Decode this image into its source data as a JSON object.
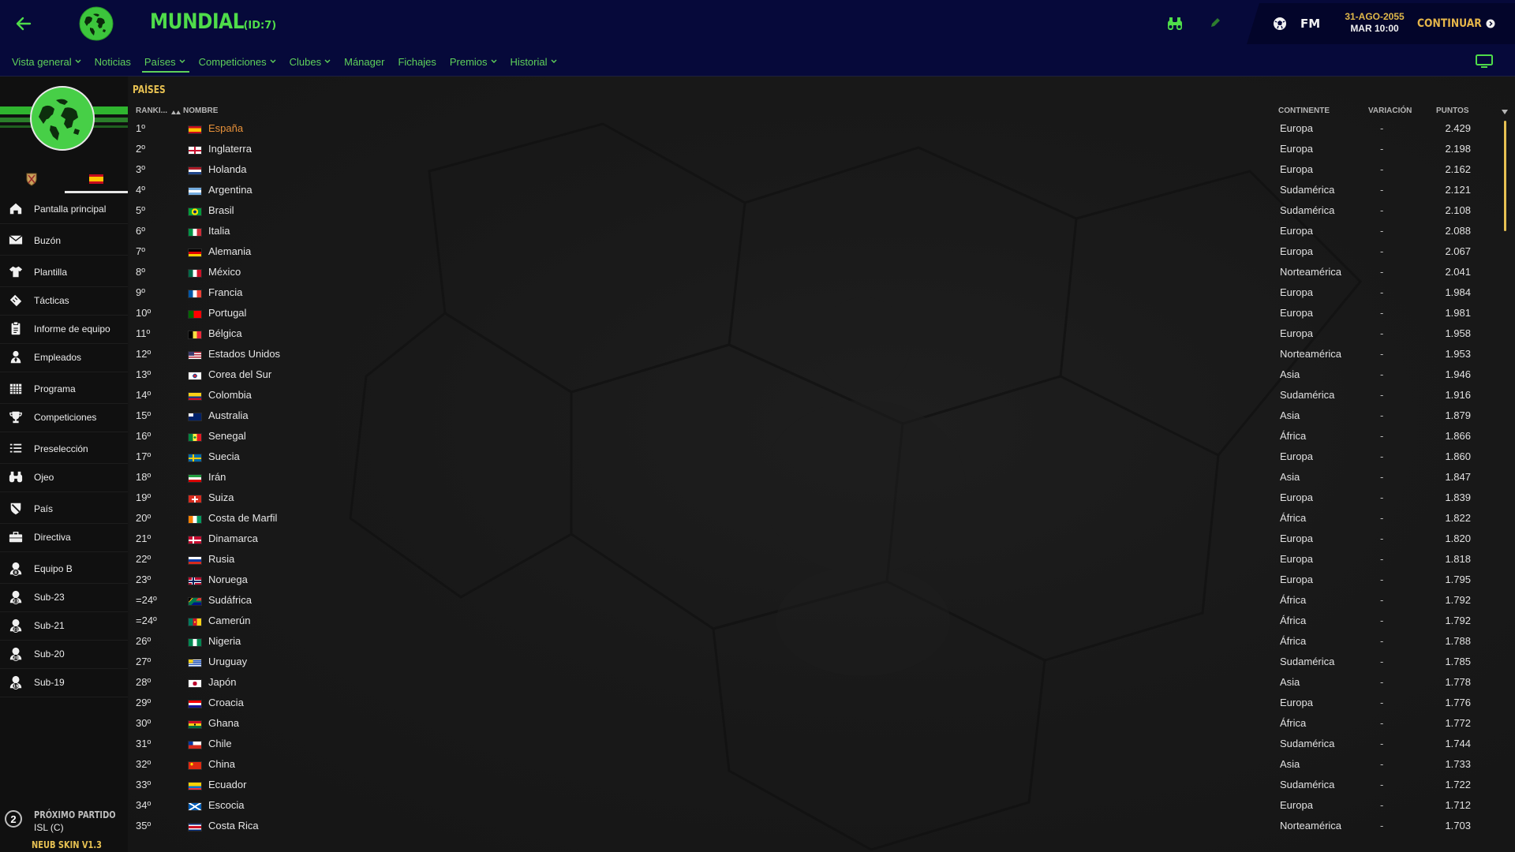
{
  "header": {
    "title": "MUNDIAL",
    "id_label": "(ID:7)",
    "fm_label": "FM",
    "date_top": "31-AGO-2055",
    "date_bottom": "MAR 10:00",
    "continue_label": "CONTINUAR"
  },
  "nav": {
    "items": [
      {
        "label": "Vista general",
        "dropdown": true
      },
      {
        "label": "Noticias",
        "dropdown": false
      },
      {
        "label": "Países",
        "dropdown": true,
        "active": true
      },
      {
        "label": "Competiciones",
        "dropdown": true
      },
      {
        "label": "Clubes",
        "dropdown": true
      },
      {
        "label": "Mánager",
        "dropdown": false
      },
      {
        "label": "Fichajes",
        "dropdown": false
      },
      {
        "label": "Premios",
        "dropdown": true
      },
      {
        "label": "Historial",
        "dropdown": true
      }
    ]
  },
  "sidebar": {
    "items": [
      {
        "label": "Pantalla principal",
        "icon": "home-icon"
      },
      {
        "label": "Buzón",
        "icon": "mail-icon"
      },
      {
        "label": "Plantilla",
        "icon": "shirt-icon"
      },
      {
        "label": "Tácticas",
        "icon": "tactics-icon"
      },
      {
        "label": "Informe de equipo",
        "icon": "report-icon"
      },
      {
        "label": "Empleados",
        "icon": "staff-icon"
      },
      {
        "label": "Programa",
        "icon": "calendar-icon"
      },
      {
        "label": "Competiciones",
        "icon": "trophy-icon"
      },
      {
        "label": "Preselección",
        "icon": "list-icon"
      },
      {
        "label": "Ojeo",
        "icon": "binoculars-icon"
      },
      {
        "label": "País",
        "icon": "shield-icon"
      },
      {
        "label": "Directiva",
        "icon": "briefcase-icon"
      },
      {
        "label": "Equipo B",
        "icon": "team-b-icon",
        "badge": "B"
      },
      {
        "label": "Sub-23",
        "icon": "u23-icon",
        "badge": "23"
      },
      {
        "label": "Sub-21",
        "icon": "u21-icon",
        "badge": "21"
      },
      {
        "label": "Sub-20",
        "icon": "u20-icon",
        "badge": "20"
      },
      {
        "label": "Sub-19",
        "icon": "u19-icon",
        "badge": "19"
      }
    ],
    "next_match": {
      "number": "2",
      "label": "PRÓXIMO PARTIDO",
      "opponent": "ISL (C)"
    },
    "skin_label": "NEUB SKIN V1.3"
  },
  "table": {
    "section_title": "PAÍSES",
    "columns": {
      "rank": "RANKI...",
      "name": "NOMBRE",
      "continent": "CONTINENTE",
      "variation": "VARIACIÓN",
      "points": "PUNTOS"
    },
    "rows": [
      {
        "rank": "1º",
        "name": "España",
        "continent": "Europa",
        "variation": "-",
        "points": "2.429",
        "flag": "es"
      },
      {
        "rank": "2º",
        "name": "Inglaterra",
        "continent": "Europa",
        "variation": "-",
        "points": "2.198",
        "flag": "en"
      },
      {
        "rank": "3º",
        "name": "Holanda",
        "continent": "Europa",
        "variation": "-",
        "points": "2.162",
        "flag": "nl"
      },
      {
        "rank": "4º",
        "name": "Argentina",
        "continent": "Sudamérica",
        "variation": "-",
        "points": "2.121",
        "flag": "ar"
      },
      {
        "rank": "5º",
        "name": "Brasil",
        "continent": "Sudamérica",
        "variation": "-",
        "points": "2.108",
        "flag": "br"
      },
      {
        "rank": "6º",
        "name": "Italia",
        "continent": "Europa",
        "variation": "-",
        "points": "2.088",
        "flag": "it"
      },
      {
        "rank": "7º",
        "name": "Alemania",
        "continent": "Europa",
        "variation": "-",
        "points": "2.067",
        "flag": "de"
      },
      {
        "rank": "8º",
        "name": "México",
        "continent": "Norteamérica",
        "variation": "-",
        "points": "2.041",
        "flag": "mx"
      },
      {
        "rank": "9º",
        "name": "Francia",
        "continent": "Europa",
        "variation": "-",
        "points": "1.984",
        "flag": "fr"
      },
      {
        "rank": "10º",
        "name": "Portugal",
        "continent": "Europa",
        "variation": "-",
        "points": "1.981",
        "flag": "pt"
      },
      {
        "rank": "11º",
        "name": "Bélgica",
        "continent": "Europa",
        "variation": "-",
        "points": "1.958",
        "flag": "be"
      },
      {
        "rank": "12º",
        "name": "Estados Unidos",
        "continent": "Norteamérica",
        "variation": "-",
        "points": "1.953",
        "flag": "us"
      },
      {
        "rank": "13º",
        "name": "Corea del Sur",
        "continent": "Asia",
        "variation": "-",
        "points": "1.946",
        "flag": "kr"
      },
      {
        "rank": "14º",
        "name": "Colombia",
        "continent": "Sudamérica",
        "variation": "-",
        "points": "1.916",
        "flag": "co"
      },
      {
        "rank": "15º",
        "name": "Australia",
        "continent": "Asia",
        "variation": "-",
        "points": "1.879",
        "flag": "au"
      },
      {
        "rank": "16º",
        "name": "Senegal",
        "continent": "África",
        "variation": "-",
        "points": "1.866",
        "flag": "sn"
      },
      {
        "rank": "17º",
        "name": "Suecia",
        "continent": "Europa",
        "variation": "-",
        "points": "1.860",
        "flag": "se"
      },
      {
        "rank": "18º",
        "name": "Irán",
        "continent": "Asia",
        "variation": "-",
        "points": "1.847",
        "flag": "ir"
      },
      {
        "rank": "19º",
        "name": "Suiza",
        "continent": "Europa",
        "variation": "-",
        "points": "1.839",
        "flag": "ch"
      },
      {
        "rank": "20º",
        "name": "Costa de Marfil",
        "continent": "África",
        "variation": "-",
        "points": "1.822",
        "flag": "ci"
      },
      {
        "rank": "21º",
        "name": "Dinamarca",
        "continent": "Europa",
        "variation": "-",
        "points": "1.820",
        "flag": "dk"
      },
      {
        "rank": "22º",
        "name": "Rusia",
        "continent": "Europa",
        "variation": "-",
        "points": "1.818",
        "flag": "ru"
      },
      {
        "rank": "23º",
        "name": "Noruega",
        "continent": "Europa",
        "variation": "-",
        "points": "1.795",
        "flag": "no"
      },
      {
        "rank": "=24º",
        "name": "Sudáfrica",
        "continent": "África",
        "variation": "-",
        "points": "1.792",
        "flag": "za"
      },
      {
        "rank": "=24º",
        "name": "Camerún",
        "continent": "África",
        "variation": "-",
        "points": "1.792",
        "flag": "cm"
      },
      {
        "rank": "26º",
        "name": "Nigeria",
        "continent": "África",
        "variation": "-",
        "points": "1.788",
        "flag": "ng"
      },
      {
        "rank": "27º",
        "name": "Uruguay",
        "continent": "Sudamérica",
        "variation": "-",
        "points": "1.785",
        "flag": "uy"
      },
      {
        "rank": "28º",
        "name": "Japón",
        "continent": "Asia",
        "variation": "-",
        "points": "1.778",
        "flag": "jp"
      },
      {
        "rank": "29º",
        "name": "Croacia",
        "continent": "Europa",
        "variation": "-",
        "points": "1.776",
        "flag": "hr"
      },
      {
        "rank": "30º",
        "name": "Ghana",
        "continent": "África",
        "variation": "-",
        "points": "1.772",
        "flag": "gh"
      },
      {
        "rank": "31º",
        "name": "Chile",
        "continent": "Sudamérica",
        "variation": "-",
        "points": "1.744",
        "flag": "cl"
      },
      {
        "rank": "32º",
        "name": "China",
        "continent": "Asia",
        "variation": "-",
        "points": "1.733",
        "flag": "cn"
      },
      {
        "rank": "33º",
        "name": "Ecuador",
        "continent": "Sudamérica",
        "variation": "-",
        "points": "1.722",
        "flag": "ec"
      },
      {
        "rank": "34º",
        "name": "Escocia",
        "continent": "Europa",
        "variation": "-",
        "points": "1.712",
        "flag": "sc"
      },
      {
        "rank": "35º",
        "name": "Costa Rica",
        "continent": "Norteamérica",
        "variation": "-",
        "points": "1.703",
        "flag": "cr"
      }
    ]
  },
  "colors": {
    "accent_green": "#4fdc4a",
    "accent_gold": "#e6c052",
    "highlight_orange": "#e8913a",
    "topbar_bg": "#06093a"
  }
}
